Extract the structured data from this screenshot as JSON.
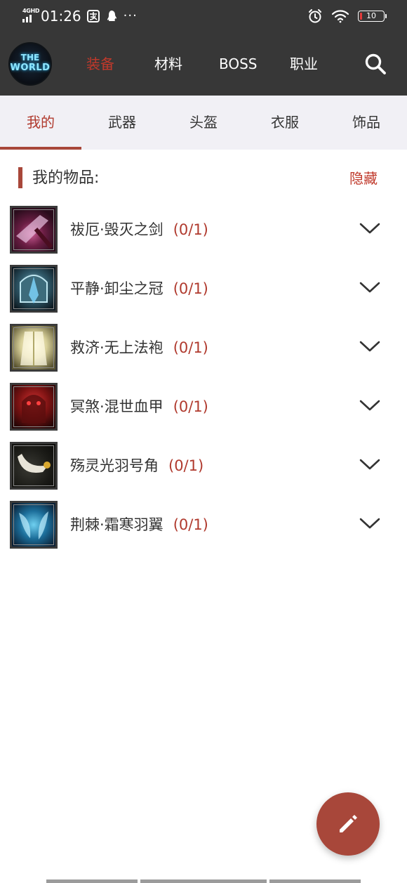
{
  "status_bar": {
    "network": "4GHD",
    "time": "01:26",
    "battery_level": "10",
    "battery_fill": 0.1,
    "icons": [
      "signal-icon",
      "alipay-icon",
      "qq-icon",
      "more-dots",
      "alarm-icon",
      "wifi-icon",
      "battery-icon"
    ]
  },
  "app_bar": {
    "logo_text_1": "THE",
    "logo_text_2": "WORLD",
    "nav": [
      {
        "label": "装备",
        "active": true
      },
      {
        "label": "材料",
        "active": false
      },
      {
        "label": "BOSS",
        "active": false
      },
      {
        "label": "职业",
        "active": false
      }
    ],
    "search_icon": "search-icon"
  },
  "category_tabs": [
    {
      "label": "我的",
      "active": true
    },
    {
      "label": "武器",
      "active": false
    },
    {
      "label": "头盔",
      "active": false
    },
    {
      "label": "衣服",
      "active": false
    },
    {
      "label": "饰品",
      "active": false
    }
  ],
  "section": {
    "title": "我的物品:",
    "hide_label": "隐藏"
  },
  "items": [
    {
      "name": "祓厄·毁灭之剑",
      "count": "(0/1)",
      "icon": "sword-icon"
    },
    {
      "name": "平静·卸尘之冠",
      "count": "(0/1)",
      "icon": "crown-icon"
    },
    {
      "name": "救济·无上法袍",
      "count": "(0/1)",
      "icon": "robe-icon"
    },
    {
      "name": "冥煞·混世血甲",
      "count": "(0/1)",
      "icon": "armor-icon"
    },
    {
      "name": "殇灵光羽号角",
      "count": "(0/1)",
      "icon": "horn-icon"
    },
    {
      "name": "荆棘·霜寒羽翼",
      "count": "(0/1)",
      "icon": "wings-icon"
    }
  ],
  "colors": {
    "accent": "#a8473a",
    "accent_text": "#c0392b",
    "bar_bg": "#373737",
    "tabs_bg": "#f1f0f5"
  },
  "fab_icon": "edit-pencil-icon"
}
